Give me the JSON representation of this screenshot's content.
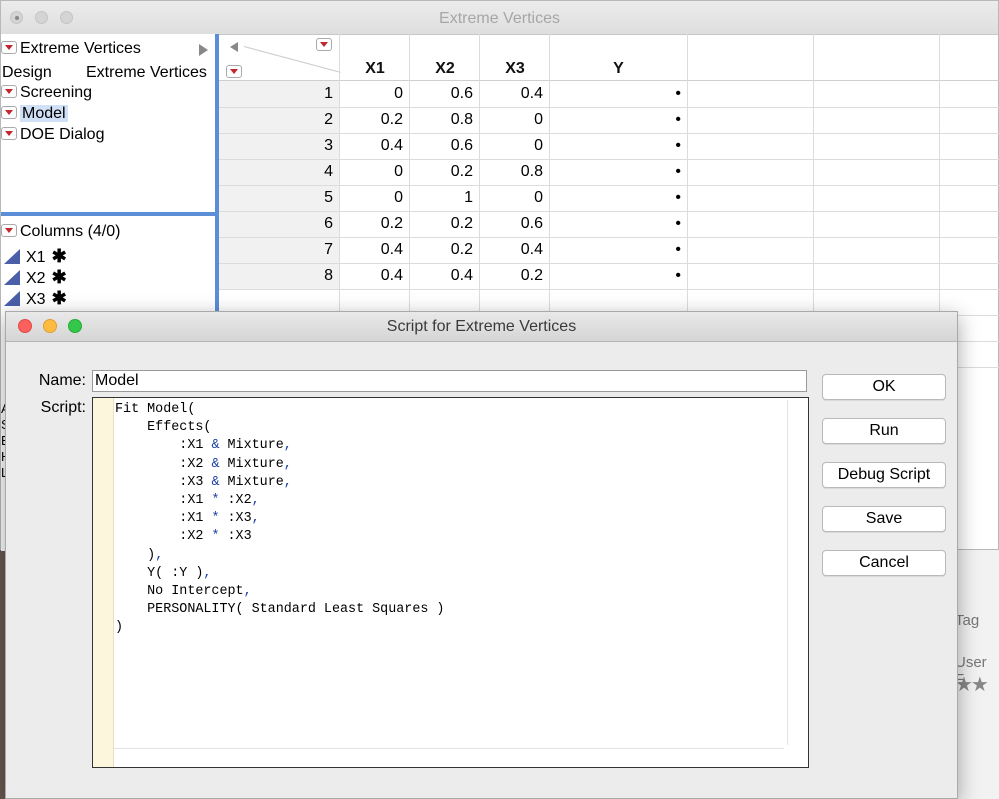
{
  "main_window": {
    "title": "Extreme Vertices",
    "left_panel": {
      "table_name": "Extreme Vertices",
      "notes": {
        "key": "Design",
        "value": "Extreme Vertices"
      },
      "scripts": [
        "Screening",
        "Model",
        "DOE Dialog"
      ],
      "selected_script": "Model",
      "columns_header": "Columns (4/0)",
      "columns": [
        {
          "name": "X1",
          "mark": "✱"
        },
        {
          "name": "X2",
          "mark": "✱"
        },
        {
          "name": "X3",
          "mark": "✱"
        }
      ]
    },
    "table": {
      "headers": [
        "X1",
        "X2",
        "X3",
        "Y"
      ],
      "rows": [
        {
          "n": "1",
          "x1": "0",
          "x2": "0.6",
          "x3": "0.4",
          "y": "•"
        },
        {
          "n": "2",
          "x1": "0.2",
          "x2": "0.8",
          "x3": "0",
          "y": "•"
        },
        {
          "n": "3",
          "x1": "0.4",
          "x2": "0.6",
          "x3": "0",
          "y": "•"
        },
        {
          "n": "4",
          "x1": "0",
          "x2": "0.2",
          "x3": "0.8",
          "y": "•"
        },
        {
          "n": "5",
          "x1": "0",
          "x2": "1",
          "x3": "0",
          "y": "•"
        },
        {
          "n": "6",
          "x1": "0.2",
          "x2": "0.2",
          "x3": "0.6",
          "y": "•"
        },
        {
          "n": "7",
          "x1": "0.4",
          "x2": "0.2",
          "x3": "0.4",
          "y": "•"
        },
        {
          "n": "8",
          "x1": "0.4",
          "x2": "0.4",
          "x3": "0.2",
          "y": "•"
        }
      ]
    }
  },
  "dialog": {
    "title": "Script for Extreme Vertices",
    "name_label": "Name:",
    "name_value": "Model",
    "script_label": "Script:",
    "buttons": {
      "ok": "OK",
      "run": "Run",
      "debug": "Debug Script",
      "save": "Save",
      "cancel": "Cancel"
    }
  },
  "background": {
    "tag_text": "Tag",
    "user_text": "User F",
    "stars": "★★"
  },
  "icons": {
    "red_triangle": "red-disclosure-triangle-icon",
    "continuous_column": "continuous-column-icon",
    "traffic_lights": [
      "close-icon",
      "minimize-icon",
      "zoom-icon"
    ]
  },
  "colors": {
    "selection_blue": "#5b8ed6",
    "close": "#fc605c",
    "minimize": "#fdbc40",
    "zoom": "#34c84a",
    "script_keyword": "#1b3fa0"
  }
}
